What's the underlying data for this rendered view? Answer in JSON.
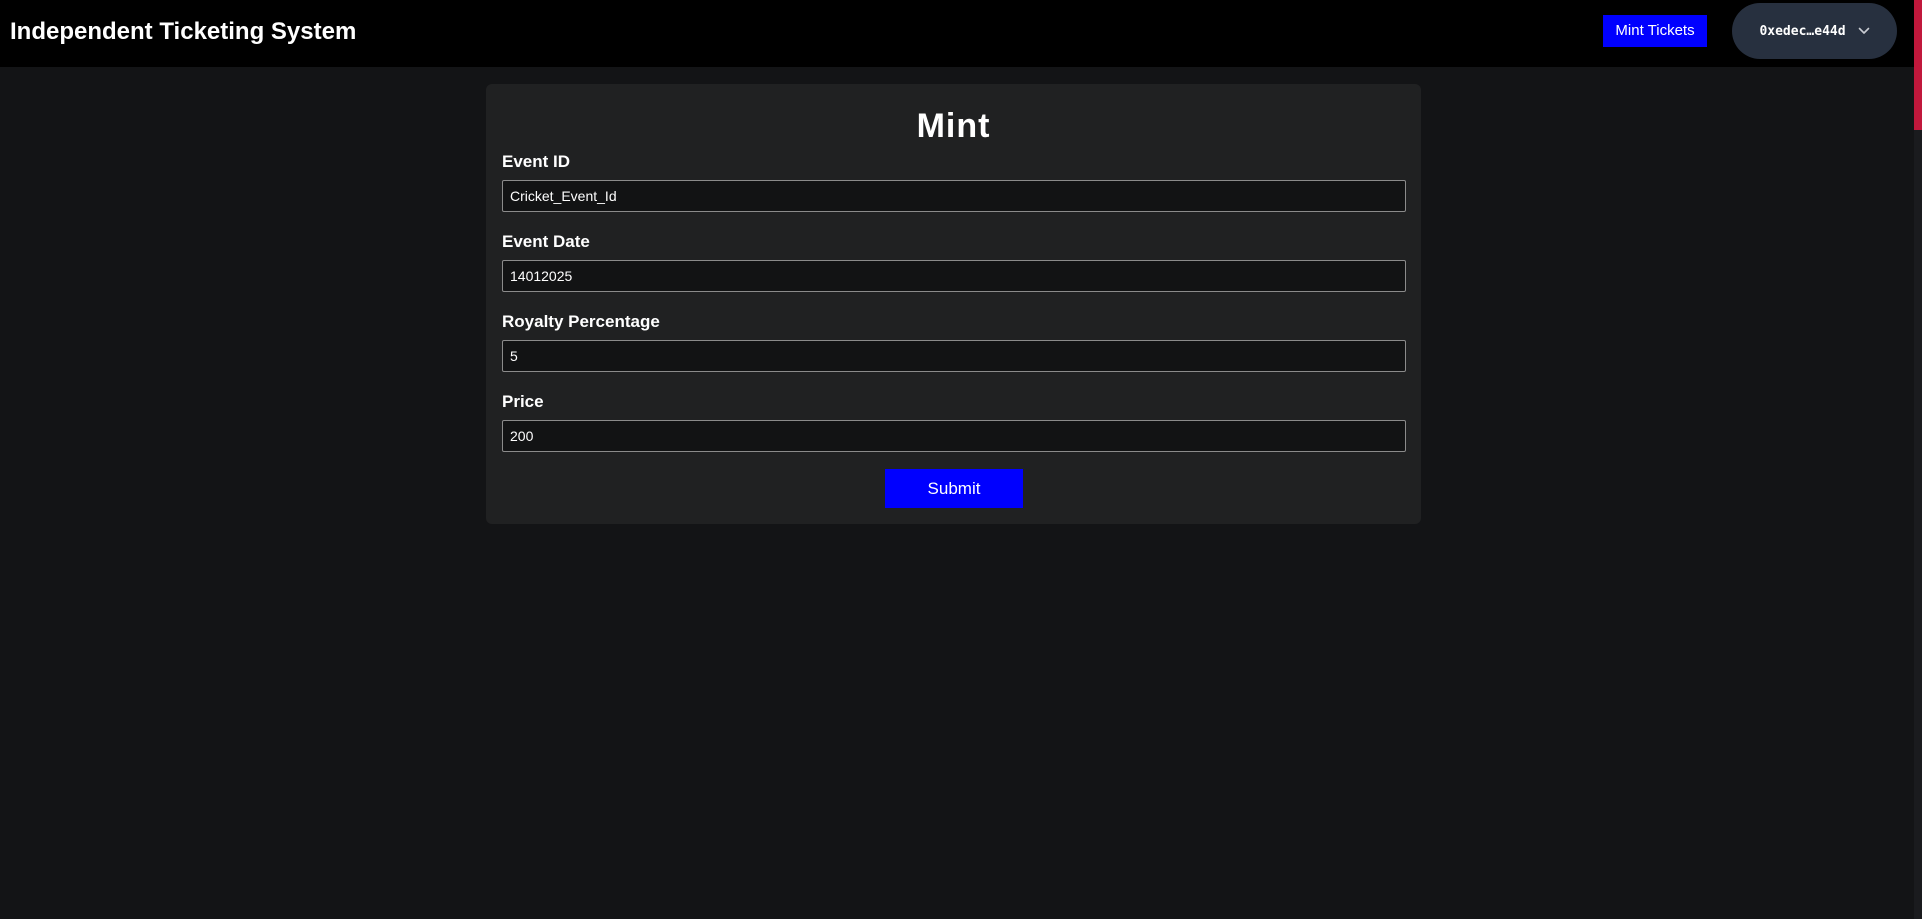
{
  "header": {
    "title": "Independent Ticketing System",
    "mint_tickets_label": "Mint Tickets",
    "wallet": {
      "address": "0xedec…e44d",
      "icon": "chevron-down-icon"
    }
  },
  "form": {
    "title": "Mint",
    "fields": [
      {
        "label": "Event ID",
        "value": "Cricket_Event_Id"
      },
      {
        "label": "Event Date",
        "value": "14012025"
      },
      {
        "label": "Royalty Percentage",
        "value": "5"
      },
      {
        "label": "Price",
        "value": "200"
      }
    ],
    "submit_label": "Submit"
  },
  "colors": {
    "accent": "#0000ff",
    "background": "#131416",
    "card": "#202122",
    "navbar": "#000000",
    "wallet_button": "#27303f"
  }
}
